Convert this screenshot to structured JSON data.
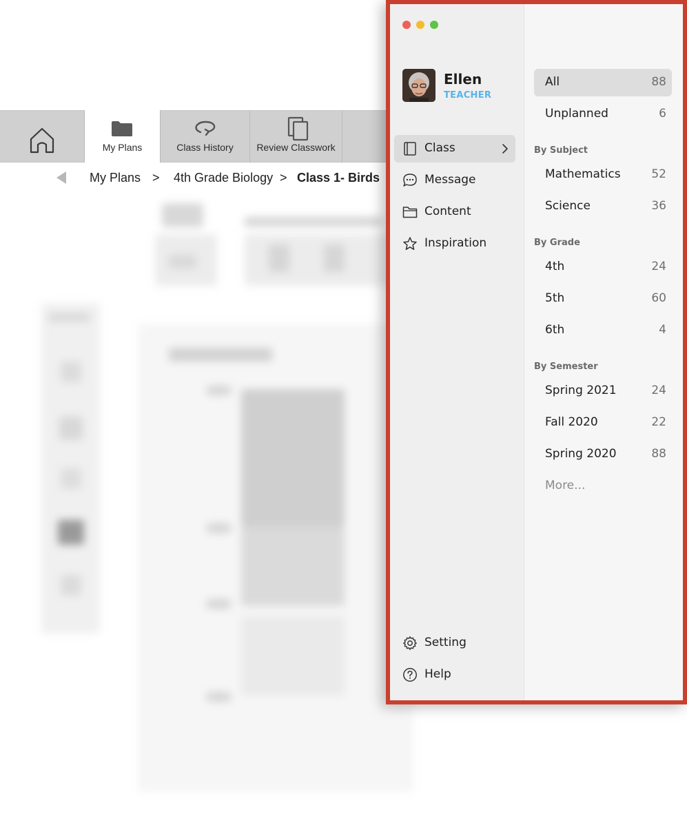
{
  "background_app": {
    "tabs": [
      {
        "label": ""
      },
      {
        "label": "My Plans"
      },
      {
        "label": "Class History"
      },
      {
        "label": "Review Classwork"
      }
    ],
    "breadcrumb": {
      "items": [
        "My Plans",
        "4th Grade Biology",
        "Class 1- Birds"
      ],
      "separator": ">"
    }
  },
  "sidebar": {
    "window_controls": {
      "close_color": "#ee5f57",
      "minimize_color": "#f5bc30",
      "zoom_color": "#5fc249"
    },
    "user": {
      "name": "Ellen",
      "role": "TEACHER",
      "role_color": "#55b4ea"
    },
    "nav": [
      {
        "label": "Class",
        "icon": "book-icon",
        "active": true
      },
      {
        "label": "Message",
        "icon": "chat-bubble-icon"
      },
      {
        "label": "Content",
        "icon": "folder-icon"
      },
      {
        "label": "Inspiration",
        "icon": "star-icon"
      }
    ],
    "footer": [
      {
        "label": "Setting",
        "icon": "gear-icon"
      },
      {
        "label": "Help",
        "icon": "help-icon"
      }
    ],
    "filters": {
      "all": {
        "label": "All",
        "count": "88"
      },
      "unplanned": {
        "label": "Unplanned",
        "count": "6"
      },
      "by_subject": {
        "title": "By Subject",
        "items": [
          {
            "label": "Mathematics",
            "count": "52"
          },
          {
            "label": "Science",
            "count": "36"
          }
        ]
      },
      "by_grade": {
        "title": "By Grade",
        "items": [
          {
            "label": "4th",
            "count": "24"
          },
          {
            "label": "5th",
            "count": "60"
          },
          {
            "label": "6th",
            "count": "4"
          }
        ]
      },
      "by_semester": {
        "title": "By Semester",
        "items": [
          {
            "label": "Spring 2021",
            "count": "24"
          },
          {
            "label": "Fall 2020",
            "count": "22"
          },
          {
            "label": "Spring 2020",
            "count": "88"
          }
        ]
      },
      "more_label": "More..."
    },
    "border_color": "#c9402f"
  }
}
